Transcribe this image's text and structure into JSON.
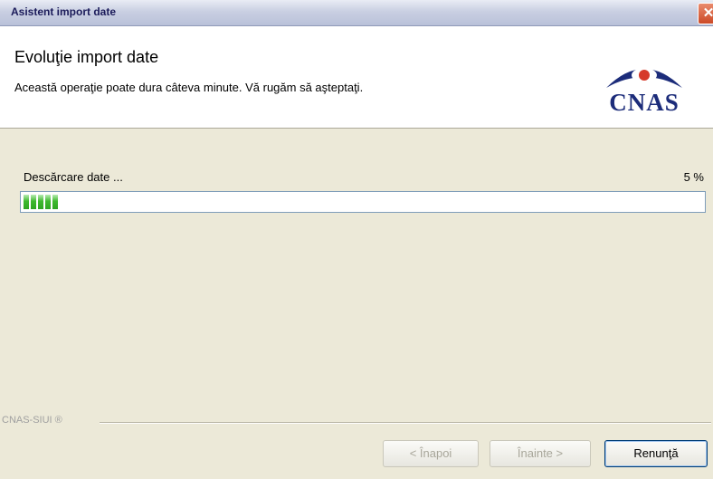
{
  "window": {
    "title": "Asistent import date",
    "close_glyph": "✕"
  },
  "header": {
    "title": "Evoluţie import date",
    "subtitle": "Această operaţie poate dura câteva minute. Vă rugăm să aşteptaţi.",
    "logo_text": "CNAS",
    "logo_color": "#1c2c7a",
    "logo_accent": "#d63a2a"
  },
  "progress": {
    "label": "Descărcare date ...",
    "percent_text": "5 %",
    "value": 0.05,
    "chunk_count": 5,
    "fill_color": "#3fb92f"
  },
  "footer": {
    "brand": "CNAS-SIUI ®",
    "back_label": "< Înapoi",
    "next_label": "Înainte >",
    "cancel_label": "Renunţă"
  }
}
